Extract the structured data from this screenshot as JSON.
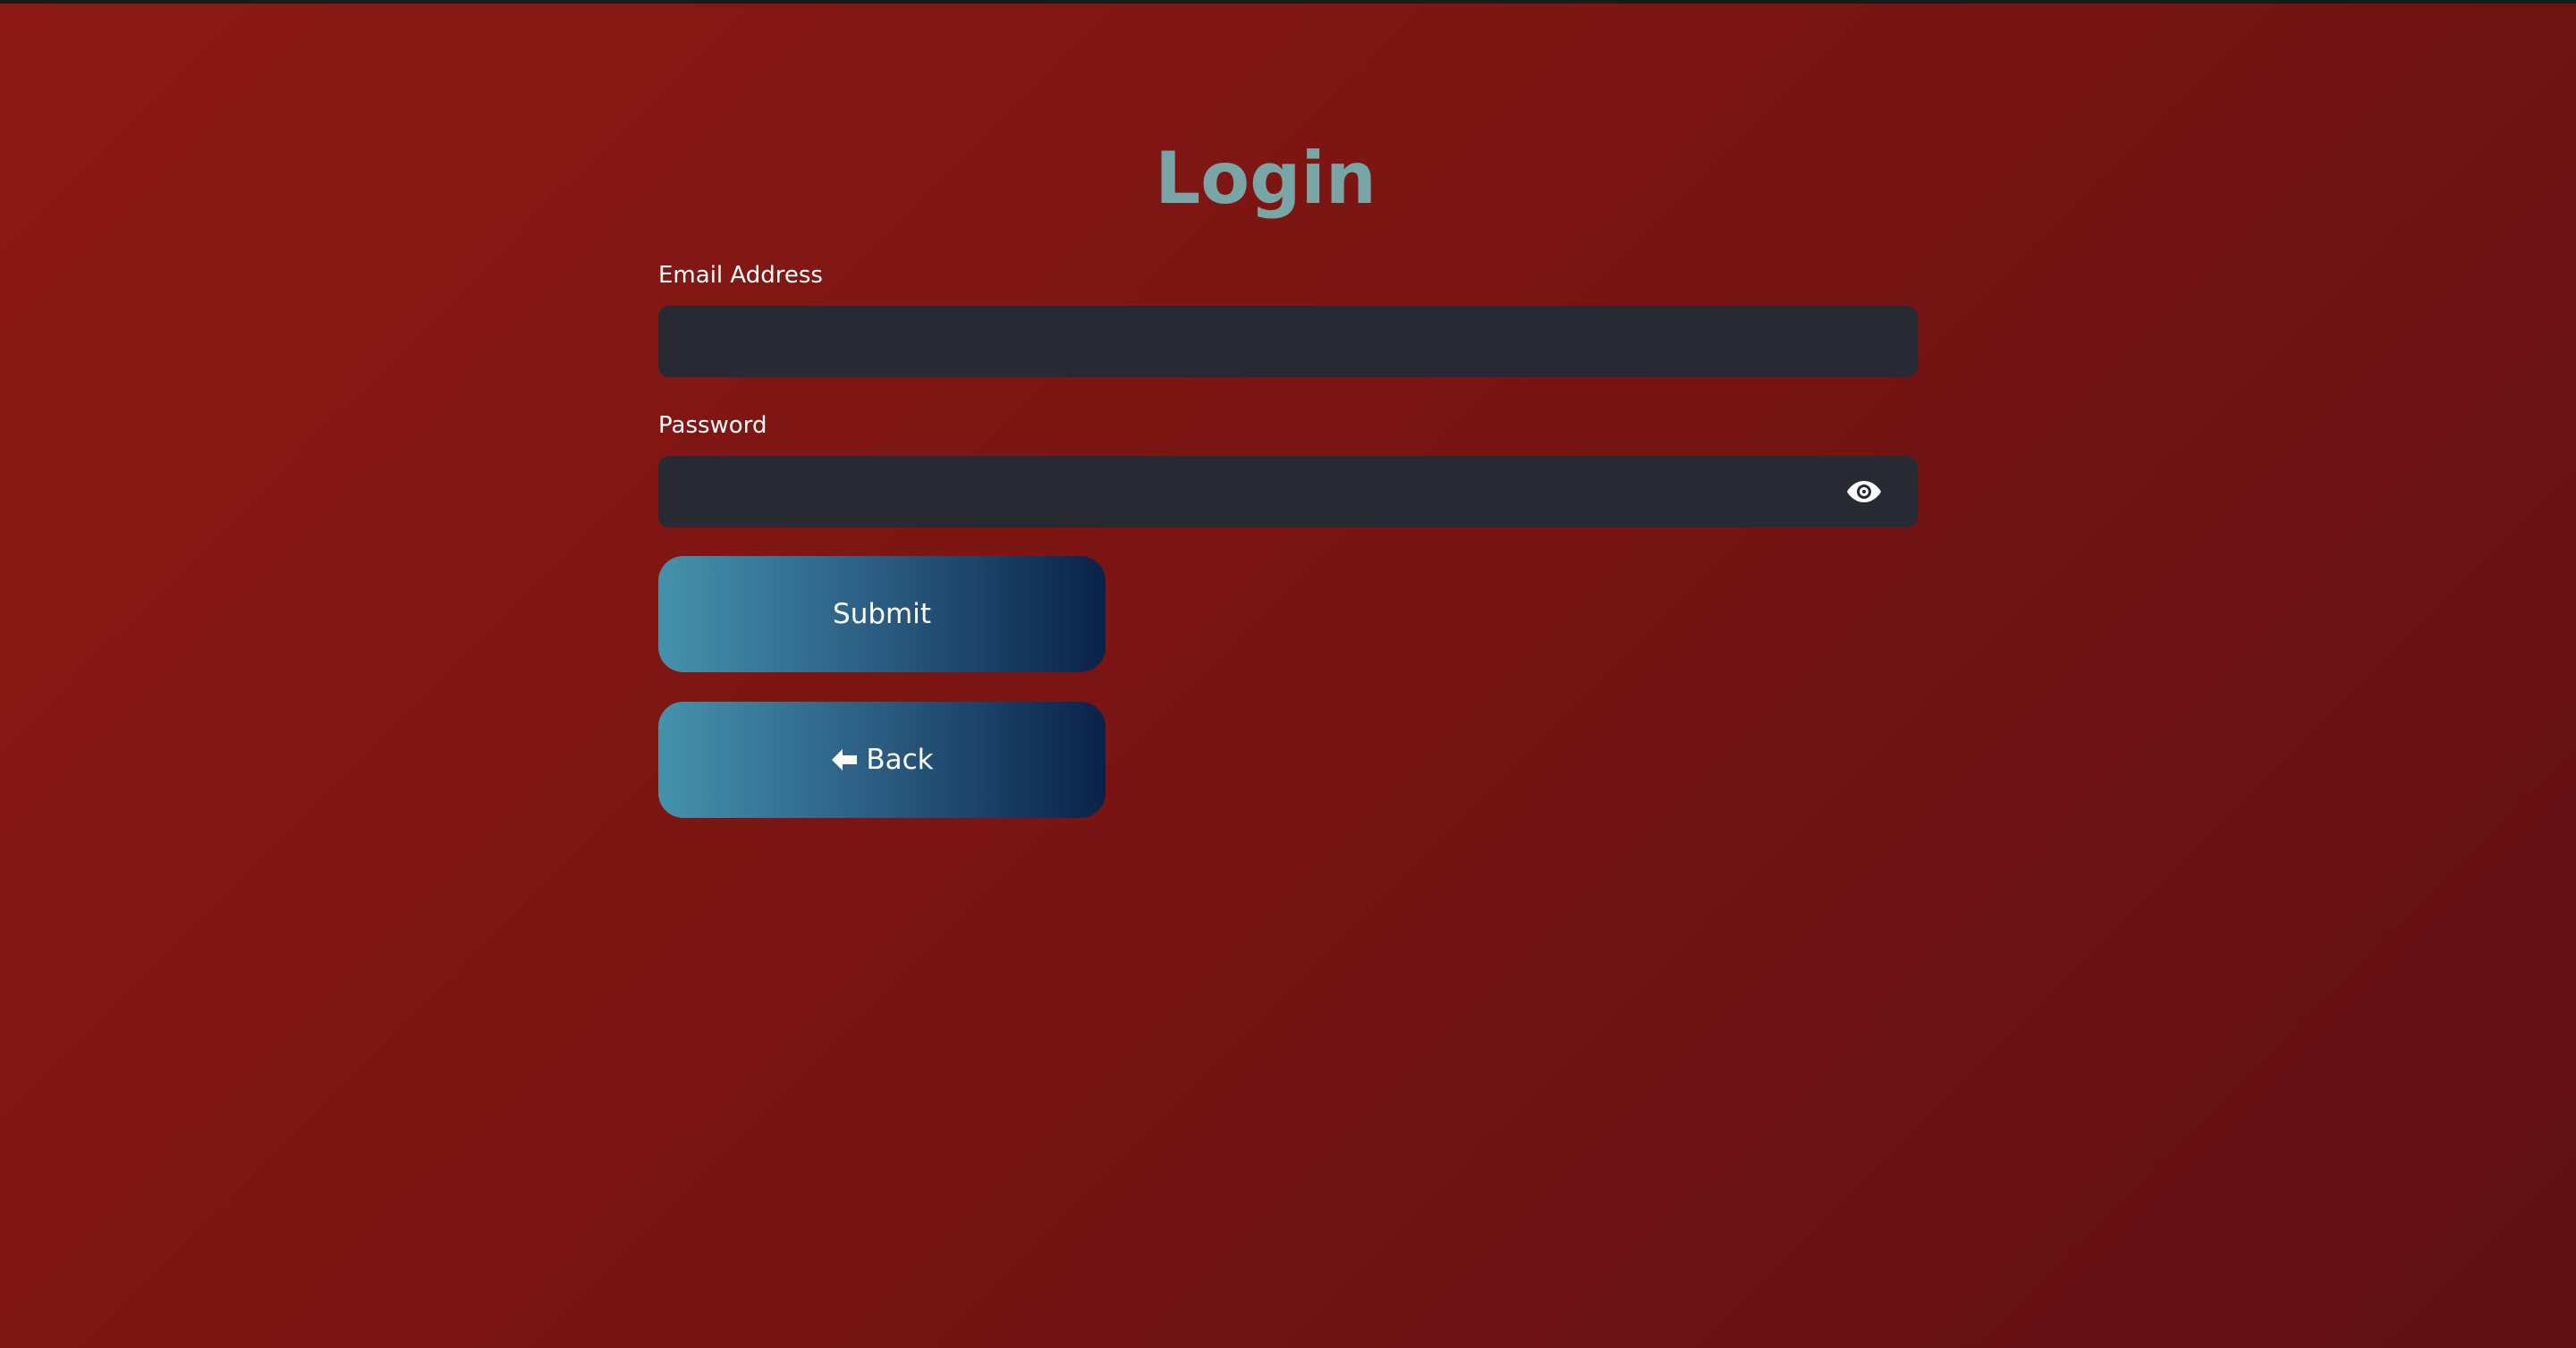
{
  "page": {
    "title": "Login"
  },
  "form": {
    "email_label": "Email Address",
    "email_value": "",
    "password_label": "Password",
    "password_value": "",
    "password_toggle_icon": "eye-icon",
    "submit_label": "Submit",
    "back_label": "Back",
    "back_icon": "arrow-left-icon"
  },
  "colors": {
    "background_start": "#8c1913",
    "background_end": "#5e0f14",
    "title": "#78a6a6",
    "input_background": "#272a33",
    "button_gradient_start": "#4592ad",
    "button_gradient_end": "#0a2248",
    "text": "#ffffff"
  }
}
